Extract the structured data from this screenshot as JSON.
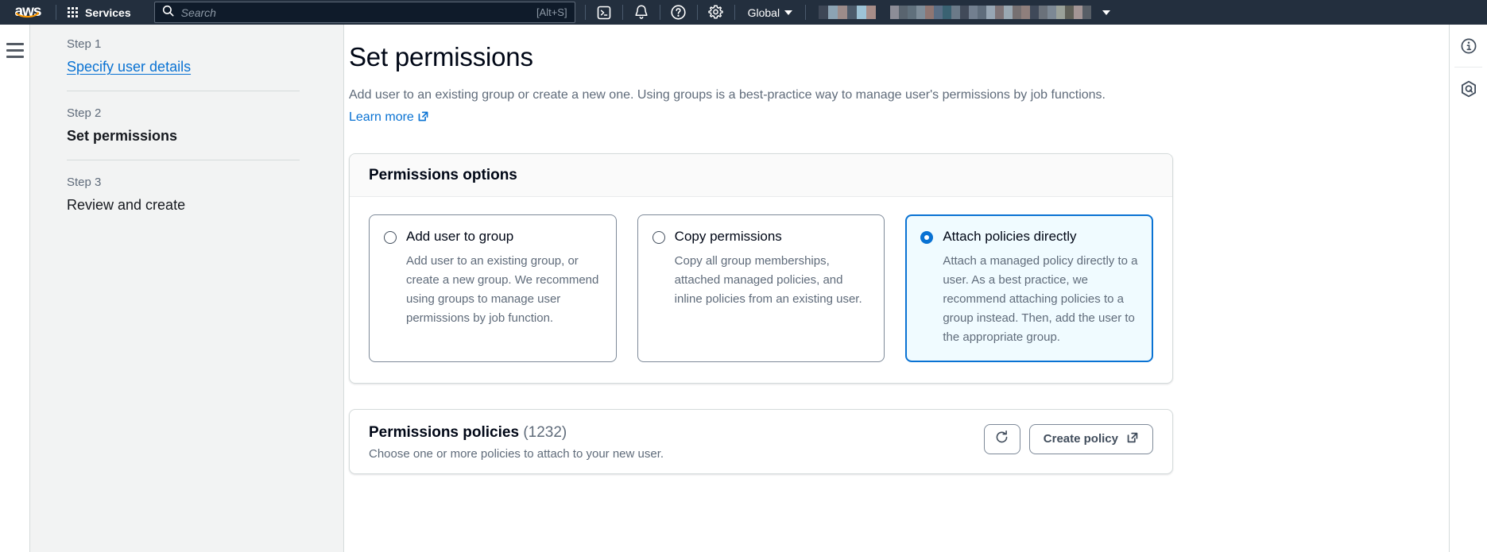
{
  "topnav": {
    "logo_alt": "aws",
    "services_label": "Services",
    "search": {
      "placeholder": "Search",
      "value": "",
      "shortcut": "[Alt+S]"
    },
    "icons": [
      {
        "name": "cloudshell-icon",
        "glyph": "cloudshell"
      },
      {
        "name": "notifications-bell-icon",
        "glyph": "bell"
      },
      {
        "name": "help-question-icon",
        "glyph": "question"
      },
      {
        "name": "settings-gear-icon",
        "glyph": "gear"
      }
    ],
    "region_label": "Global",
    "account_redacted": true,
    "redacted_group_1": [
      "#3e4756",
      "#8ca3b3",
      "#9c8c8a",
      "#4c5b6b",
      "#9dc3d6",
      "#a78d88"
    ],
    "redacted_group_2": [
      "#8d8d97",
      "#59646f",
      "#60707c",
      "#7e8d99",
      "#8f7672",
      "#5a6e85",
      "#3a6272",
      "#6b7a88",
      "#414a59",
      "#727f8f",
      "#5f6d7c",
      "#97a6b4",
      "#7e7477",
      "#9aa8b2",
      "#767071",
      "#8f7f7c",
      "#3f4959",
      "#6a717a",
      "#7c8894",
      "#9aa199",
      "#5f6058",
      "#a39595",
      "#575e66"
    ]
  },
  "sidebar": {
    "menu_icon": "hamburger-icon",
    "steps": [
      {
        "num": "Step 1",
        "title": "Specify user details",
        "state": "link"
      },
      {
        "num": "Step 2",
        "title": "Set permissions",
        "state": "current"
      },
      {
        "num": "Step 3",
        "title": "Review and create",
        "state": "pending"
      }
    ]
  },
  "main": {
    "title": "Set permissions",
    "description_part1": "Add user to an existing group or create a new one. Using groups is a best-practice way to manage user's permissions by job functions. ",
    "learn_more_label": "Learn more",
    "permissions_options": {
      "heading": "Permissions options",
      "cards": [
        {
          "label": "Add user to group",
          "description": "Add user to an existing group, or create a new group. We recommend using groups to manage user permissions by job function.",
          "selected": false
        },
        {
          "label": "Copy permissions",
          "description": "Copy all group memberships, attached managed policies, and inline policies from an existing user.",
          "selected": false
        },
        {
          "label": "Attach policies directly",
          "description": "Attach a managed policy directly to a user. As a best practice, we recommend attaching policies to a group instead. Then, add the user to the appropriate group.",
          "selected": true
        }
      ]
    },
    "permissions_policies": {
      "heading": "Permissions policies",
      "count": "(1232)",
      "description": "Choose one or more policies to attach to your new user.",
      "refresh_button": "refresh-icon",
      "create_policy_label": "Create policy"
    }
  },
  "right_rail": {
    "items": [
      {
        "name": "info-panel-icon"
      },
      {
        "name": "amazon-q-icon"
      }
    ]
  },
  "colors": {
    "accent_blue": "#0972d3",
    "nav_background": "#232f3e",
    "selected_card_bg": "#f0fbff",
    "sidebar_bg": "#f2f3f3"
  }
}
